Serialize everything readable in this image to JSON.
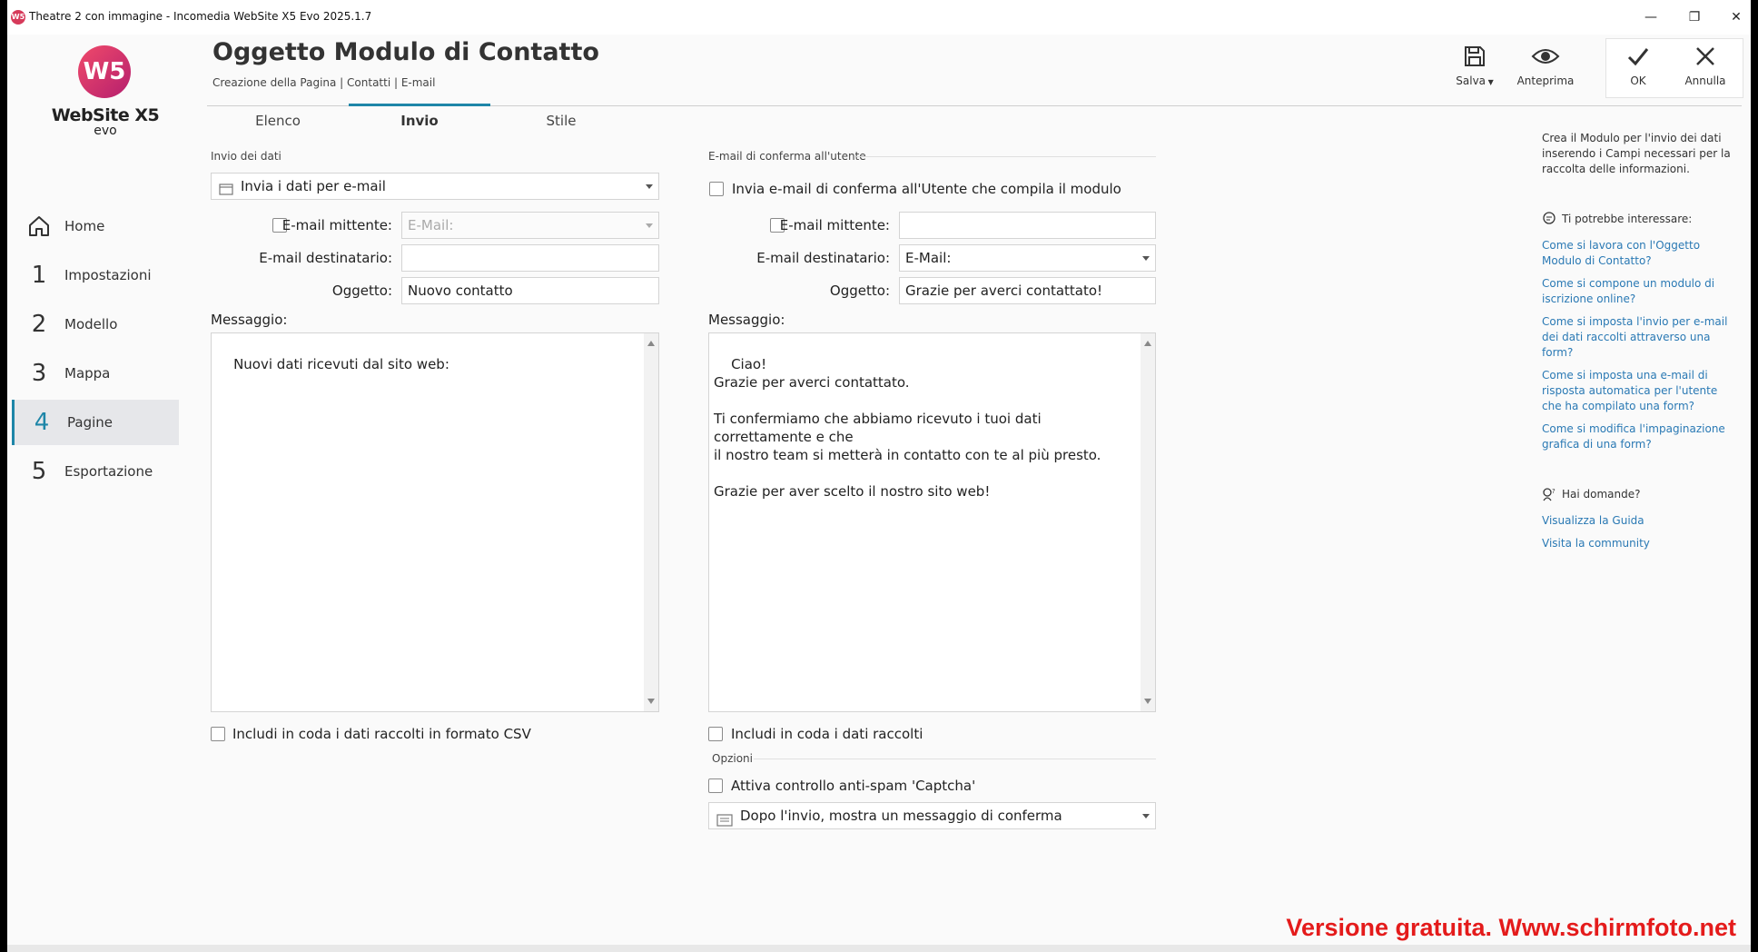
{
  "window": {
    "title": "Theatre 2 con immagine - Incomedia WebSite X5 Evo 2025.1.7",
    "app_icon": "W5"
  },
  "logo": {
    "mark": "W5",
    "name": "WebSite X5",
    "edition": "evo"
  },
  "nav": {
    "items": [
      {
        "num": "",
        "icon": "home-icon",
        "label": "Home"
      },
      {
        "num": "1",
        "label": "Impostazioni"
      },
      {
        "num": "2",
        "label": "Modello"
      },
      {
        "num": "3",
        "label": "Mappa"
      },
      {
        "num": "4",
        "label": "Pagine",
        "active": true
      },
      {
        "num": "5",
        "label": "Esportazione"
      }
    ]
  },
  "header": {
    "title": "Oggetto Modulo di Contatto",
    "breadcrumb": "Creazione della Pagina | Contatti  | E-mail"
  },
  "toolbar": {
    "save_label": "Salva",
    "preview_label": "Anteprima",
    "ok_label": "OK",
    "cancel_label": "Annulla"
  },
  "tabs": [
    {
      "label": "Elenco"
    },
    {
      "label": "Invio",
      "active": true
    },
    {
      "label": "Stile"
    }
  ],
  "left": {
    "section": "Invio dei dati",
    "send_mode": "Invia i dati per e-mail",
    "sender_label": "E-mail mittente:",
    "sender_placeholder": "E-Mail:",
    "recipient_label": "E-mail destinatario:",
    "recipient_value": "",
    "subject_label": "Oggetto:",
    "subject_value": "Nuovo contatto",
    "message_label": "Messaggio:",
    "message_value": "Nuovi dati ricevuti dal sito web:",
    "csv_label": "Includi in coda i dati raccolti in formato CSV"
  },
  "right": {
    "section": "E-mail di conferma all'utente",
    "confirm_label": "Invia e-mail di conferma all'Utente che compila il modulo",
    "sender_label": "E-mail mittente:",
    "sender_value": "",
    "recipient_label": "E-mail destinatario:",
    "recipient_value": "E-Mail:",
    "subject_label": "Oggetto:",
    "subject_value": "Grazie per averci contattato!",
    "message_label": "Messaggio:",
    "message_value": "Ciao!\nGrazie per averci contattato.\n\nTi confermiamo che abbiamo ricevuto i tuoi dati correttamente e che\nil nostro team si metterà in contatto con te al più presto.\n\nGrazie per aver scelto il nostro sito web!",
    "include_label": "Includi in coda i dati raccolti",
    "options_section": "Opzioni",
    "captcha_label": "Attiva controllo anti-spam 'Captcha'",
    "after_send": "Dopo l'invio, mostra un messaggio di conferma"
  },
  "help": {
    "intro": "Crea il Modulo per l'invio dei dati inserendo i Campi necessari per la raccolta delle informazioni.",
    "interest_heading": "Ti potrebbe interessare:",
    "links": [
      "Come si lavora con l'Oggetto Modulo di Contatto?",
      "Come si compone un modulo di iscrizione online?",
      "Come si imposta l'invio per e-mail dei dati raccolti attraverso una form?",
      "Come si imposta una e-mail di risposta automatica per l'utente che ha compilato una form?",
      "Come si modifica l'impaginazione grafica di una form?"
    ],
    "questions_heading": "Hai domande?",
    "guide_link": "Visualizza la Guida",
    "community_link": "Visita la community"
  },
  "watermark": "Versione gratuita. Www.schirmfoto.net",
  "colors": {
    "accent": "#1e86a8",
    "link": "#2a79b4",
    "watermark": "#e41b1b"
  }
}
